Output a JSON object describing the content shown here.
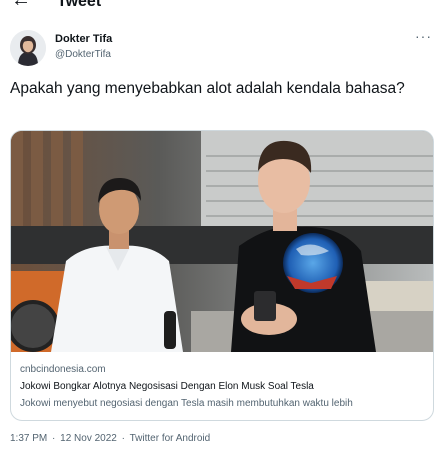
{
  "header": {
    "back_icon": "left-arrow-icon",
    "title": "Tweet"
  },
  "author": {
    "name": "Dokter Tifa",
    "handle": "@DokterTifa",
    "more_icon": "more-options-icon"
  },
  "tweet": {
    "text": "Apakah yang menyebabkan alot adalah kendala bahasa?"
  },
  "card": {
    "domain": "cnbcindonesia.com",
    "title": "Jokowi Bongkar Alotnya Negosisasi Dengan Elon Musk Soal Tesla",
    "description": "Jokowi menyebut negosiasi dengan Tesla masih membutuhkan waktu lebih"
  },
  "meta": {
    "time": "1:37 PM",
    "separator": "·",
    "date": "12 Nov 2022",
    "source": "Twitter for Android"
  },
  "colors": {
    "text": "#0f1419",
    "secondary": "#536471",
    "border": "#cfd9de"
  }
}
